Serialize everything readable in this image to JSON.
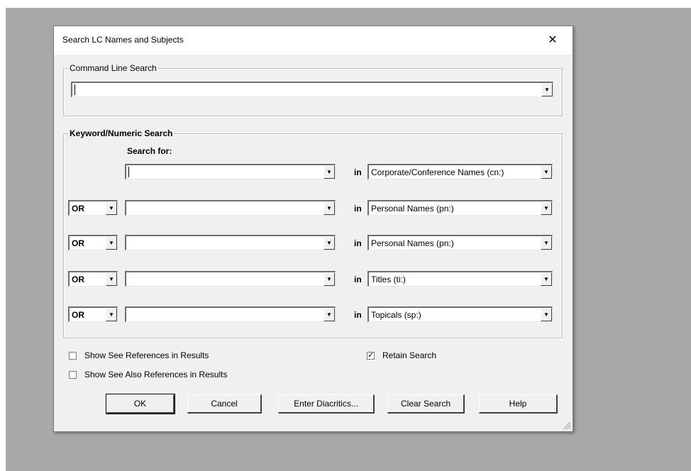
{
  "dialog": {
    "title": "Search LC Names and Subjects",
    "close_glyph": "✕"
  },
  "command_line": {
    "legend": "Command Line Search",
    "value": ""
  },
  "keyword": {
    "legend": "Keyword/Numeric Search",
    "search_for_label": "Search for:",
    "in_label": "in",
    "rows": [
      {
        "operator": "",
        "term": "",
        "index": "Corporate/Conference Names (cn:)"
      },
      {
        "operator": "OR",
        "term": "",
        "index": "Personal Names (pn:)"
      },
      {
        "operator": "OR",
        "term": "",
        "index": "Personal Names (pn:)"
      },
      {
        "operator": "OR",
        "term": "",
        "index": "Titles (ti:)"
      },
      {
        "operator": "OR",
        "term": "",
        "index": "Topicals (sp:)"
      }
    ]
  },
  "options": {
    "show_see_refs": {
      "label": "Show See References in Results",
      "checked": false
    },
    "show_see_also_refs": {
      "label": "Show See Also References in Results",
      "checked": false
    },
    "retain_search": {
      "label": "Retain Search",
      "checked": true
    }
  },
  "buttons": {
    "ok": "OK",
    "cancel": "Cancel",
    "diacritics": "Enter Diacritics...",
    "clear": "Clear Search",
    "help": "Help"
  }
}
